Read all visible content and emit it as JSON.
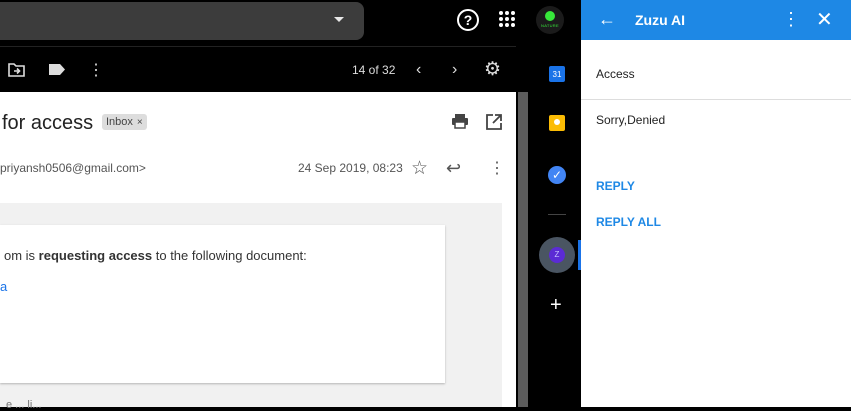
{
  "toolbar": {
    "pager": "14 of 32"
  },
  "account": {
    "avatar_text": "NATURE"
  },
  "email": {
    "subject": "for access",
    "inbox_label": "Inbox",
    "inbox_close": "×",
    "sender": "priyansh0506@gmail.com>",
    "date": "24 Sep 2019, 08:23",
    "body_prefix": "om is ",
    "body_bold": "requesting access",
    "body_suffix": " to the following document:",
    "doc_link": "a",
    "footer": "e ... li..."
  },
  "sidebar": {
    "calendar_day": "31",
    "addon_letter": "Z"
  },
  "zuzu": {
    "title": "Zuzu AI",
    "access_text": "Access",
    "reply_body": "Sorry,Denied",
    "reply_label": "REPLY",
    "reply_all_label": "REPLY ALL"
  },
  "colors": {
    "accent": "#1e88e5",
    "link": "#1a73e8",
    "avatar_green": "#37e83a"
  }
}
